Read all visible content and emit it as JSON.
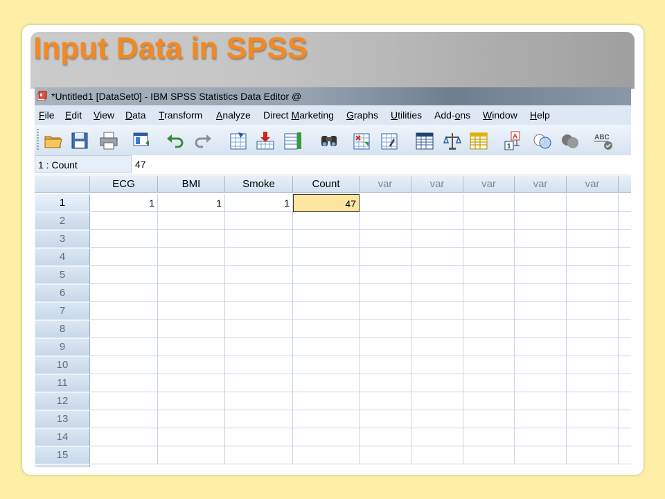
{
  "slide": {
    "title": "Input Data in SPSS"
  },
  "window": {
    "title": "*Untitled1 [DataSet0] - IBM SPSS Statistics Data Editor @"
  },
  "menu": [
    {
      "label": "File",
      "key": "F"
    },
    {
      "label": "Edit",
      "key": "E"
    },
    {
      "label": "View",
      "key": "V"
    },
    {
      "label": "Data",
      "key": "D"
    },
    {
      "label": "Transform",
      "key": "T"
    },
    {
      "label": "Analyze",
      "key": "A"
    },
    {
      "label": "Direct Marketing",
      "key": "M"
    },
    {
      "label": "Graphs",
      "key": "G"
    },
    {
      "label": "Utilities",
      "key": "U"
    },
    {
      "label": "Add-ons",
      "key": "o"
    },
    {
      "label": "Window",
      "key": "W"
    },
    {
      "label": "Help",
      "key": "H"
    }
  ],
  "toolbar": [
    "open-folder-icon",
    "save-icon",
    "print-icon",
    "recall-dialog-icon",
    "undo-icon",
    "redo-icon",
    "goto-case-icon",
    "goto-variable-icon",
    "variables-icon",
    "find-icon",
    "insert-cases-icon",
    "insert-variable-icon",
    "split-file-icon",
    "weight-cases-icon",
    "select-cases-icon",
    "value-labels-icon",
    "use-sets-icon",
    "show-all-variables-icon",
    "spell-check-icon"
  ],
  "cellbar": {
    "reference": "1 : Count",
    "value": "47"
  },
  "grid": {
    "columns": [
      "ECG",
      "BMI",
      "Smoke",
      "Count",
      "var",
      "var",
      "var",
      "var",
      "var"
    ],
    "row_labels": [
      "1",
      "2",
      "3",
      "4",
      "5",
      "6",
      "7",
      "8",
      "9",
      "10",
      "11",
      "12",
      "13",
      "14",
      "15"
    ],
    "rows": [
      [
        "1",
        "1",
        "1",
        "47",
        "",
        "",
        "",
        "",
        ""
      ]
    ],
    "selected": {
      "row": 1,
      "column": "Count"
    }
  },
  "colors": {
    "title": "#f28a22",
    "background": "#fdf0a6",
    "selected_cell": "#fde7a0"
  }
}
